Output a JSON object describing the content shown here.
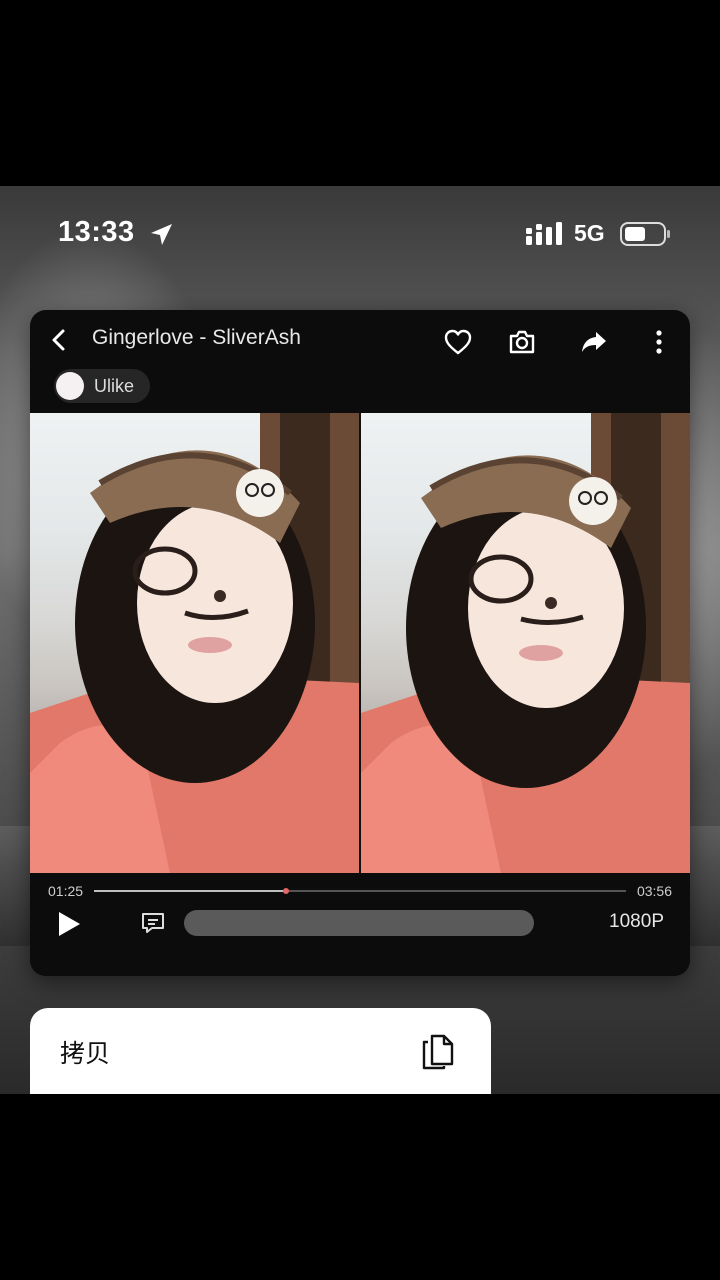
{
  "status": {
    "time": "13:33",
    "network": "5G"
  },
  "player": {
    "title": "Gingerlove - SliverAsh",
    "user_chip": "Ulike",
    "current_time": "01:25",
    "total_time": "03:56",
    "progress_fraction": 0.36,
    "quality": "1080P"
  },
  "context_menu": {
    "copy_label": "拷贝"
  },
  "icons": [
    "back-icon",
    "heart-icon",
    "camera-icon",
    "share-icon",
    "more-icon",
    "play-icon",
    "danmaku-icon",
    "copy-icon",
    "location-arrow-icon",
    "signal-icon",
    "battery-icon"
  ],
  "colors": {
    "accent_knob": "#e66666",
    "player_bg": "#0c0c0c",
    "menu_bg": "#ffffff"
  }
}
